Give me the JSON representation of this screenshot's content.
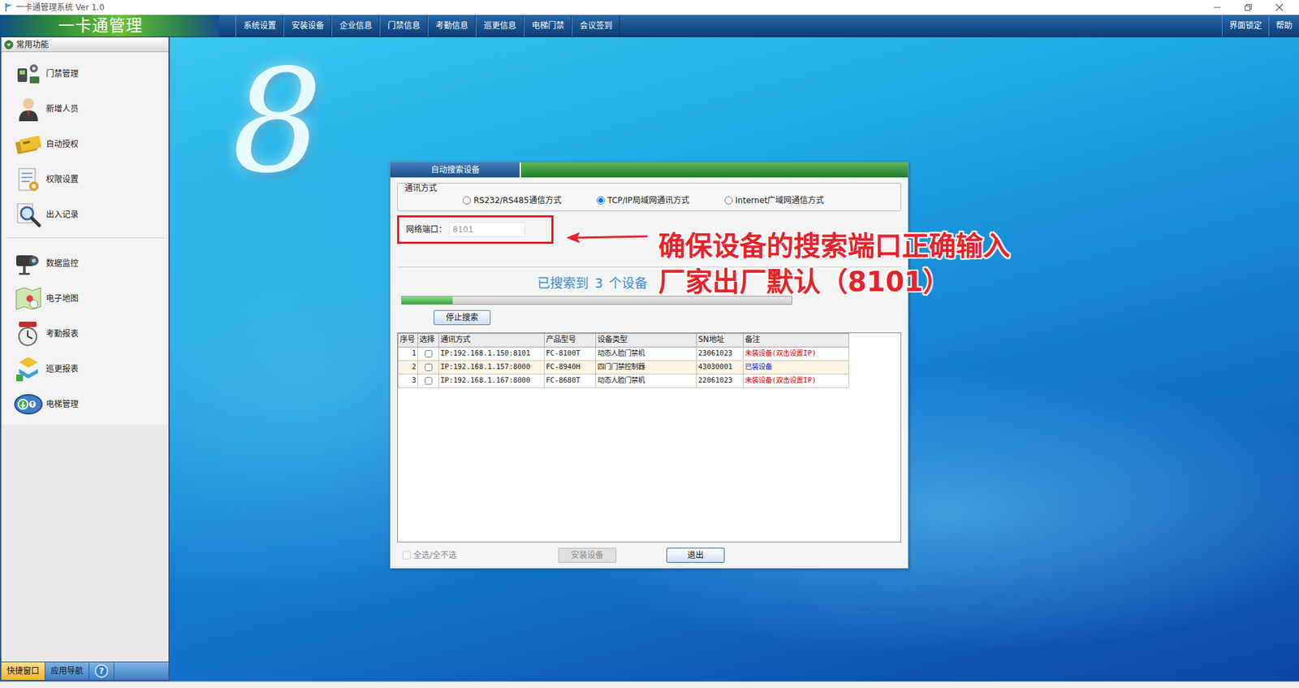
{
  "window": {
    "title": "一卡通管理系统 Ver 1.0"
  },
  "header": {
    "logo": "一卡通管理",
    "menu": [
      "系统设置",
      "安装设备",
      "企业信息",
      "门禁信息",
      "考勤信息",
      "巡更信息",
      "电梯门禁",
      "会议签到"
    ],
    "tools": [
      "界面锁定",
      "帮助"
    ]
  },
  "sidebar": {
    "title": "常用功能",
    "groups": [
      {
        "items": [
          {
            "label": "门禁管理"
          },
          {
            "label": "新增人员"
          },
          {
            "label": "自动授权"
          },
          {
            "label": "权限设置"
          },
          {
            "label": "出入记录"
          }
        ]
      },
      {
        "items": [
          {
            "label": "数据监控"
          },
          {
            "label": "电子地图"
          },
          {
            "label": "考勤报表"
          },
          {
            "label": "巡更报表"
          },
          {
            "label": "电梯管理"
          }
        ]
      }
    ]
  },
  "sidebar_tabs": [
    {
      "label": "快捷窗口",
      "selected": true
    },
    {
      "label": "应用导航",
      "selected": false
    },
    {
      "label": "?",
      "selected": false
    }
  ],
  "wallpaper": {
    "mark": "8"
  },
  "dialog": {
    "title": "自动搜索设备",
    "comm": {
      "legend": "通讯方式",
      "options": [
        {
          "label": "RS232/RS485通信方式",
          "selected": false
        },
        {
          "label": "TCP/IP局域网通讯方式",
          "selected": true
        },
        {
          "label": "Internet广域网通信方式",
          "selected": false
        }
      ]
    },
    "port": {
      "label": "网络端口：",
      "value": "8101",
      "disabled": true
    },
    "status": {
      "prefix": "已搜索到",
      "count": "3",
      "suffix": "个设备"
    },
    "progress": {
      "level": 0.13
    },
    "stop_button": "停止搜索",
    "table": {
      "columns": [
        "序号",
        "选择",
        "通讯方式",
        "产品型号",
        "设备类型",
        "SN地址",
        "备注"
      ],
      "rows": [
        {
          "cells": [
            "1",
            "IP:192.168.1.150:8101",
            "FC-8100T",
            "动态人脸门禁机",
            "23061023",
            "未装设备(双击设置IP)"
          ],
          "checked": false,
          "selected": false,
          "color": "#e00000"
        },
        {
          "cells": [
            "2",
            "IP:192.168.1.157:8000",
            "FC-8940H",
            "四门门禁控制器",
            "43030001",
            "已装设备"
          ],
          "checked": false,
          "selected": true,
          "color": "#0a1fe0"
        },
        {
          "cells": [
            "3",
            "IP:192.168.1.167:8000",
            "FC-8680T",
            "动态人脸门禁机",
            "22061023",
            "未装设备(双击设置IP)"
          ],
          "checked": false,
          "selected": false,
          "color": "#e00000"
        }
      ]
    },
    "select_all": {
      "label": "全选/全不选",
      "checked": false,
      "disabled": true
    },
    "buttons": [
      {
        "label": "安装设备",
        "disabled": true
      },
      {
        "label": "退出",
        "disabled": false
      }
    ]
  },
  "annotation": {
    "lines": [
      "确保设备的搜索端口正确输入",
      "厂家出厂默认（8101）"
    ]
  }
}
